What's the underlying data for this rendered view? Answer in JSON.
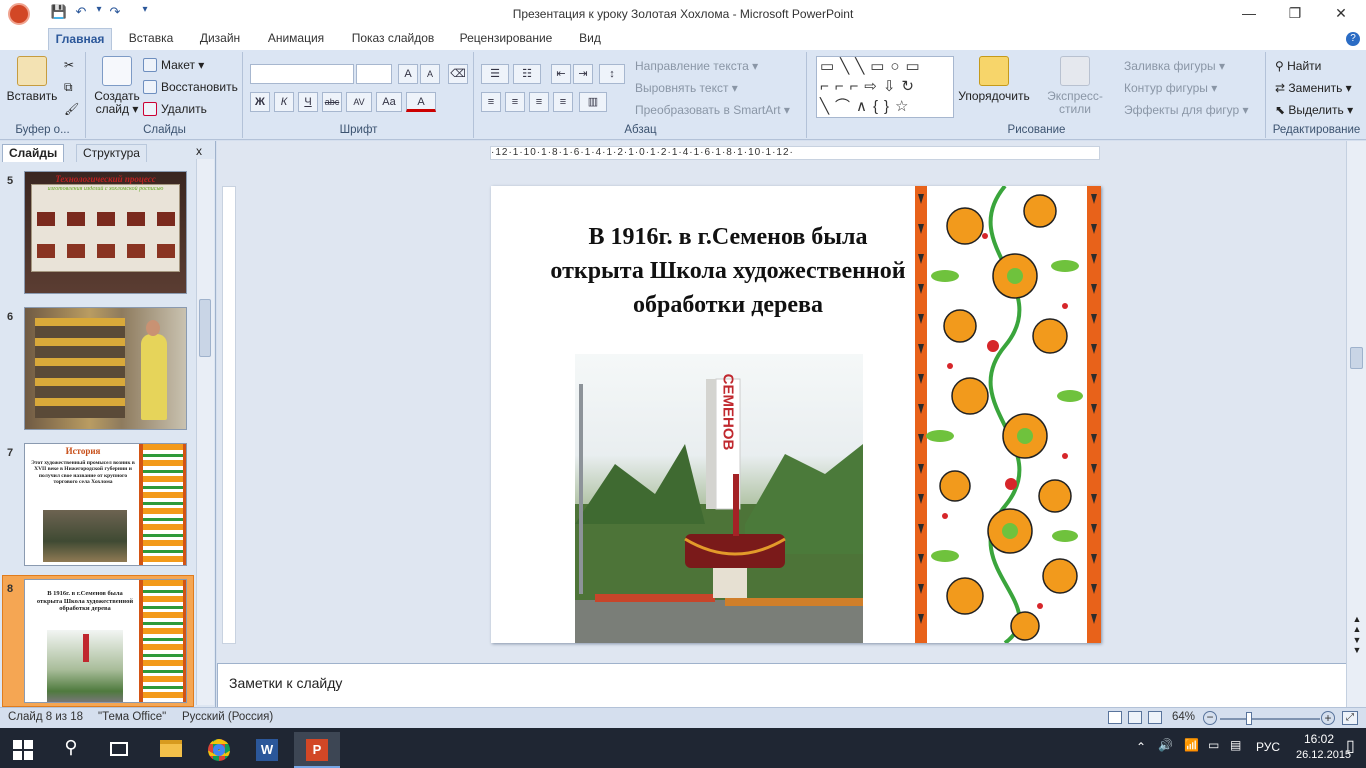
{
  "window": {
    "title": "Презентация к уроку Золотая Хохлома - Microsoft PowerPoint",
    "minimize": "—",
    "restore": "❐",
    "close": "✕"
  },
  "qat": {
    "save": "💾",
    "undo": "↶",
    "redo": "↷",
    "more": "▾"
  },
  "tabs": [
    "Главная",
    "Вставка",
    "Дизайн",
    "Анимация",
    "Показ слайдов",
    "Рецензирование",
    "Вид"
  ],
  "ribbon": {
    "clipboard": {
      "paste": "Вставить",
      "label": "Буфер о..."
    },
    "slides": {
      "new_slide": "Создать слайд ▾",
      "layout": "Макет ▾",
      "reset": "Восстановить",
      "delete": "Удалить",
      "label": "Слайды"
    },
    "font": {
      "bold": "Ж",
      "italic": "К",
      "underline": "Ч",
      "strike": "abc",
      "spacing": "AV",
      "case": "Aa",
      "color": "A",
      "grow": "A",
      "shrink": "A",
      "label": "Шрифт"
    },
    "paragraph": {
      "text_direction": "Направление текста ▾",
      "align_text": "Выровнять текст ▾",
      "smartart": "Преобразовать в SmartArt ▾",
      "label": "Абзац"
    },
    "drawing": {
      "arrange": "Упорядочить",
      "quick_styles": "Экспресс-стили",
      "fill": "Заливка фигуры ▾",
      "outline": "Контур фигуры ▾",
      "effects": "Эффекты для фигур ▾",
      "label": "Рисование"
    },
    "editing": {
      "find": "Найти",
      "replace": "Заменить ▾",
      "select": "Выделить ▾",
      "label": "Редактирование"
    }
  },
  "panel": {
    "tab_slides": "Слайды",
    "tab_outline": "Структура",
    "close": "x",
    "thumbnails": [
      {
        "num": "5",
        "title": "Технологический процесс",
        "subtitle": "изготовления изделий с хохломской росписью"
      },
      {
        "num": "6"
      },
      {
        "num": "7",
        "title": "История",
        "text": "Этот художественный промысел возник в XVII веке в Нижегородской губернии и получил свое название от крупного торгового села Хохлома"
      },
      {
        "num": "8",
        "text": "В 1916г. в г.Семенов была открыта Школа художественной обработки дерева"
      }
    ]
  },
  "slide": {
    "text": "В 1916г. в г.Семенов была открыта Школа художественной обработки дерева",
    "sign_text": "СЕМЕНОВ"
  },
  "ruler": "·12·1·10·1·8·1·6·1·4·1·2·1·0·1·2·1·4·1·6·1·8·1·10·1·12·",
  "notes_placeholder": "Заметки к слайду",
  "status": {
    "slide": "Слайд 8 из 18",
    "theme": "\"Тема Office\"",
    "language": "Русский (Россия)",
    "zoom": "64%"
  },
  "taskbar": {
    "lang": "РУС",
    "time": "16:02",
    "date": "26.12.2015"
  }
}
